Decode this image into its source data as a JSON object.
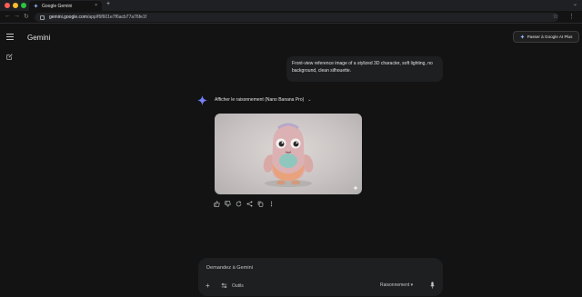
{
  "browser": {
    "tab_title": "Google Gemini",
    "new_tab_glyph": "+",
    "close_glyph": "×",
    "url_host": "gemini.google.com",
    "url_path": "/app/f6f601e7f6acb77a76fe1f"
  },
  "header": {
    "brand": "Gemini",
    "upgrade_label": "Passer à Google AI Plus"
  },
  "conversation": {
    "user_prompt": "Front-view reference image of a stylized 3D character, soft lighting, no background, clean silhouette.",
    "reasoning_label": "Afficher le raisonnement (Nano Banana Pro)"
  },
  "composer": {
    "placeholder": "Demandez à Gemini",
    "tools_label": "Outils",
    "mode_label": "Raisonnement ▾"
  },
  "colors": {
    "background": "#131314",
    "surface": "#1e1f20",
    "gemini_blue": "#4f8df7"
  },
  "icons": [
    "hamburger-icon",
    "edit-icon",
    "gemini-spark-icon",
    "thumb-up-icon",
    "thumb-down-icon",
    "refresh-icon",
    "share-icon",
    "copy-icon",
    "more-icon",
    "mic-icon",
    "tools-icon"
  ]
}
